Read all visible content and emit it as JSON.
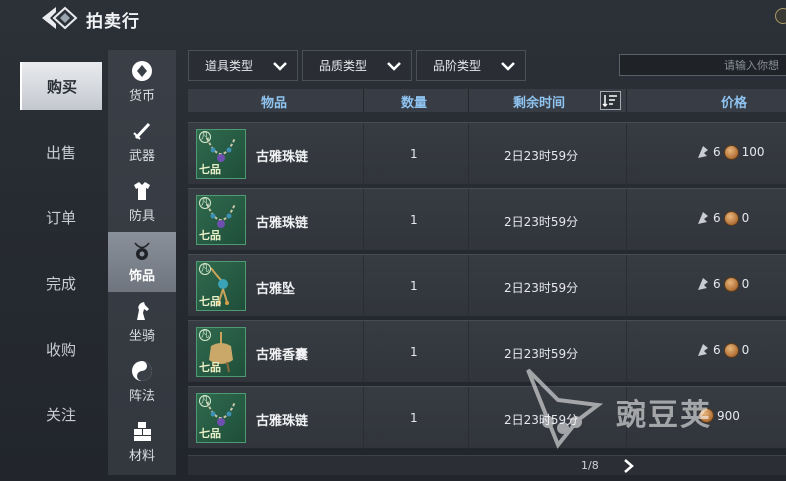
{
  "header": {
    "title": "拍卖行"
  },
  "left_nav": [
    {
      "label": "购买",
      "active": true
    },
    {
      "label": "出售"
    },
    {
      "label": "订单"
    },
    {
      "label": "完成"
    },
    {
      "label": "收购"
    },
    {
      "label": "关注"
    }
  ],
  "categories": [
    {
      "label": "货币",
      "icon": "currency-icon"
    },
    {
      "label": "武器",
      "icon": "sword-icon"
    },
    {
      "label": "防具",
      "icon": "armor-icon"
    },
    {
      "label": "饰品",
      "icon": "pendant-icon",
      "active": true
    },
    {
      "label": "坐骑",
      "icon": "horse-icon"
    },
    {
      "label": "阵法",
      "icon": "yinyang-icon"
    },
    {
      "label": "材料",
      "icon": "material-icon"
    }
  ],
  "filters": {
    "item_type": "道具类型",
    "quality_type": "品质类型",
    "tier_type": "品阶类型",
    "search_placeholder": "请输入你想"
  },
  "table": {
    "headers": {
      "item": "物品",
      "quantity": "数量",
      "remaining_time": "剩余时间",
      "price": "价格"
    },
    "rows": [
      {
        "name": "古雅珠链",
        "quantity": "1",
        "time": "2日23时59分",
        "price_main": "6",
        "price_coin": "100",
        "tier": "凡",
        "quality": "七品",
        "icon": "necklace-icon"
      },
      {
        "name": "古雅珠链",
        "quantity": "1",
        "time": "2日23时59分",
        "price_main": "6",
        "price_coin": "0",
        "tier": "凡",
        "quality": "七品",
        "icon": "necklace-icon"
      },
      {
        "name": "古雅坠",
        "quantity": "1",
        "time": "2日23时59分",
        "price_main": "6",
        "price_coin": "0",
        "tier": "凡",
        "quality": "七品",
        "icon": "pendant-item-icon"
      },
      {
        "name": "古雅香囊",
        "quantity": "1",
        "time": "2日23时59分",
        "price_main": "6",
        "price_coin": "0",
        "tier": "凡",
        "quality": "七品",
        "icon": "sachet-icon"
      },
      {
        "name": "古雅珠链",
        "quantity": "1",
        "time": "2日23时59分",
        "price_main": "",
        "price_coin": "900",
        "tier": "凡",
        "quality": "七品",
        "icon": "necklace-icon"
      }
    ]
  },
  "pagination": {
    "indicator": "1/8"
  },
  "watermark": {
    "text": "豌豆荚"
  },
  "colors": {
    "header_text": "#8fc3f0",
    "active_nav": "#e9ebee",
    "item_bg": "#2f6a4d"
  }
}
